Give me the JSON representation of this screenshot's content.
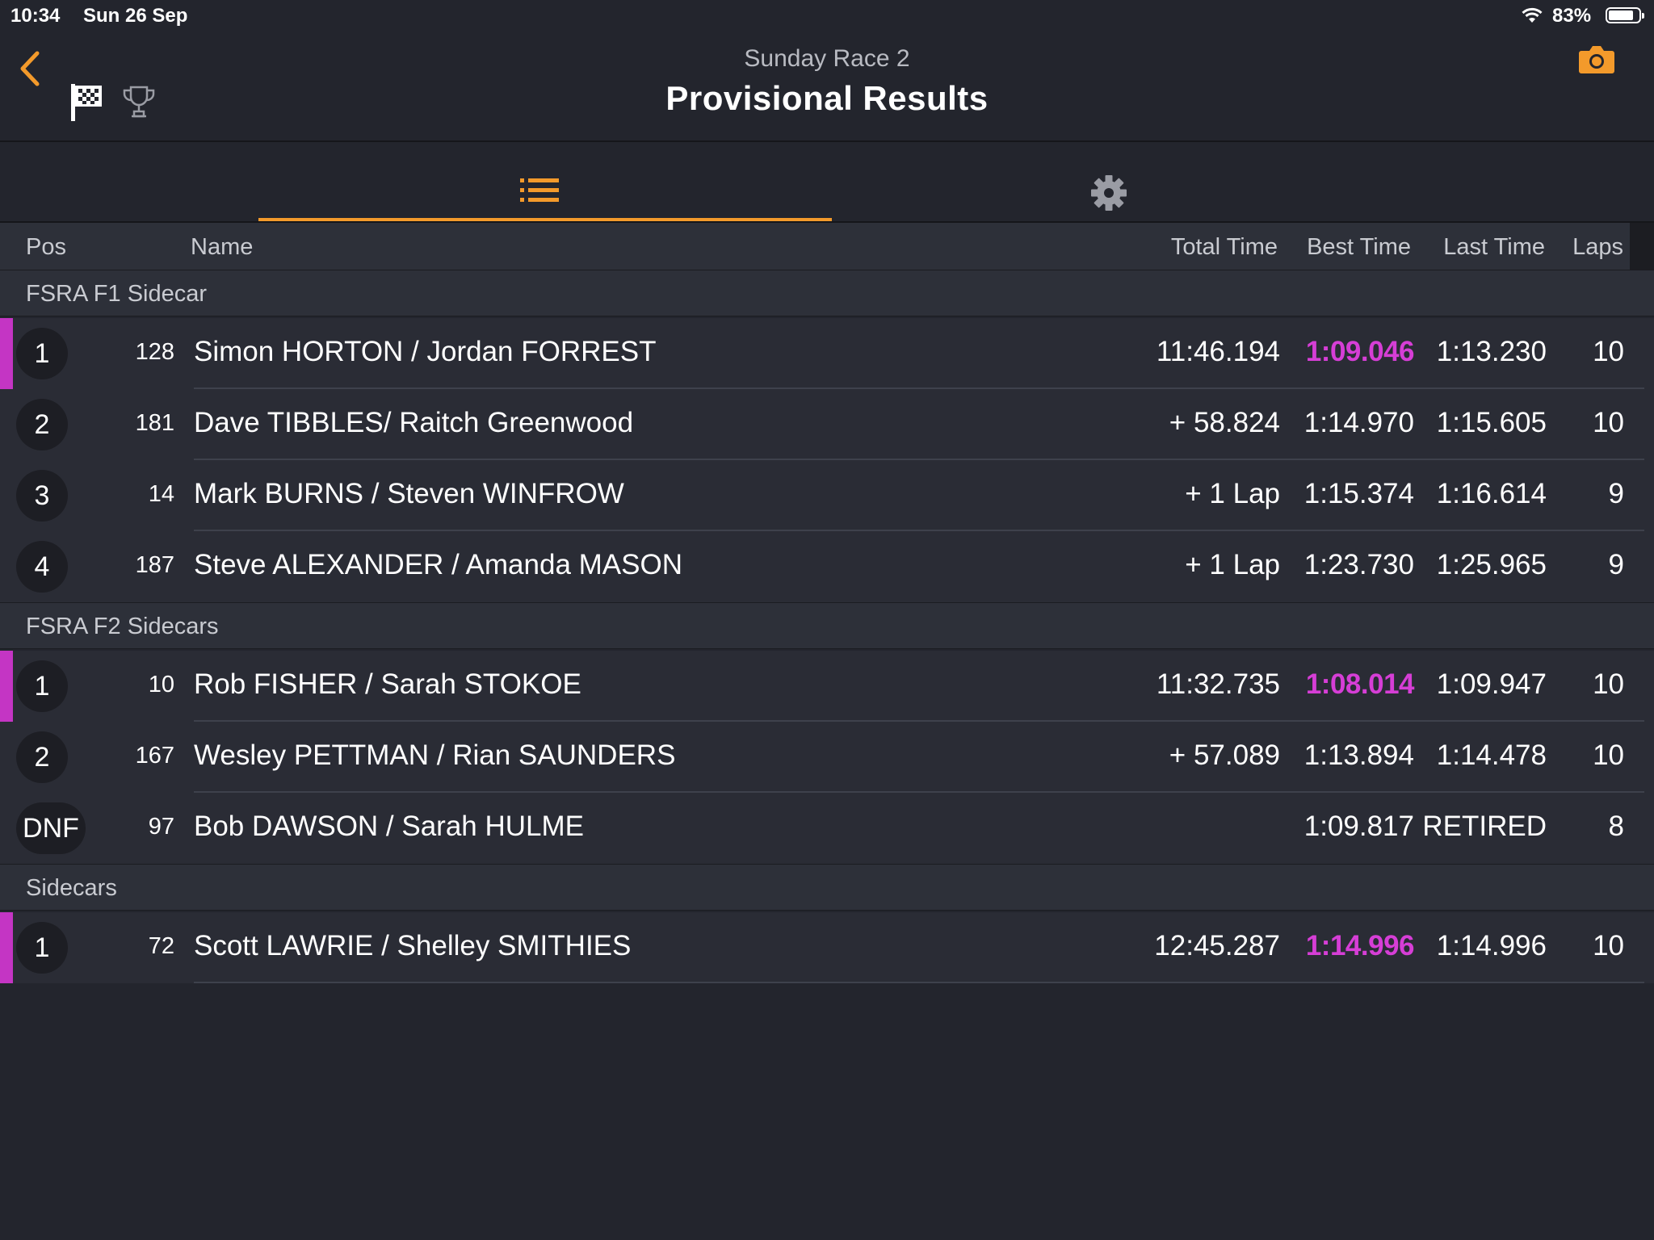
{
  "status_bar": {
    "time": "10:34",
    "date": "Sun 26 Sep",
    "battery": "83%",
    "battery_level": 0.83
  },
  "header": {
    "subtitle": "Sunday Race 2",
    "title": "Provisional Results"
  },
  "icons": {
    "back": "chevron-left-icon",
    "flag": "checkered-flag-icon",
    "trophy": "trophy-icon",
    "camera": "camera-icon",
    "list_tab": "list-icon",
    "settings_tab": "gear-icon"
  },
  "colors": {
    "accent": "#f39a2b",
    "fastest": "#d63ed6",
    "background": "#23252d"
  },
  "columns": {
    "pos": "Pos",
    "name": "Name",
    "total": "Total Time",
    "best": "Best Time",
    "last": "Last Time",
    "laps": "Laps"
  },
  "groups": [
    {
      "name": "FSRA F1 Sidecar",
      "rows": [
        {
          "pos": "1",
          "num": "128",
          "name": "Simon HORTON / Jordan FORREST",
          "total": "11:46.194",
          "best": "1:09.046",
          "last": "1:13.230",
          "laps": "10"
        },
        {
          "pos": "2",
          "num": "181",
          "name": "Dave TIBBLES/ Raitch Greenwood",
          "total": "+ 58.824",
          "best": "1:14.970",
          "last": "1:15.605",
          "laps": "10"
        },
        {
          "pos": "3",
          "num": "14",
          "name": "Mark BURNS / Steven WINFROW",
          "total": "+ 1 Lap",
          "best": "1:15.374",
          "last": "1:16.614",
          "laps": "9"
        },
        {
          "pos": "4",
          "num": "187",
          "name": "Steve ALEXANDER / Amanda MASON",
          "total": "+ 1 Lap",
          "best": "1:23.730",
          "last": "1:25.965",
          "laps": "9"
        }
      ]
    },
    {
      "name": "FSRA F2 Sidecars",
      "rows": [
        {
          "pos": "1",
          "num": "10",
          "name": "Rob FISHER / Sarah STOKOE",
          "total": "11:32.735",
          "best": "1:08.014",
          "last": "1:09.947",
          "laps": "10"
        },
        {
          "pos": "2",
          "num": "167",
          "name": "Wesley PETTMAN / Rian SAUNDERS",
          "total": "+ 57.089",
          "best": "1:13.894",
          "last": "1:14.478",
          "laps": "10"
        },
        {
          "pos": "DNF",
          "num": "97",
          "name": "Bob DAWSON / Sarah HULME",
          "total": "",
          "best": "1:09.817",
          "last": "RETIRED",
          "laps": "8"
        }
      ]
    },
    {
      "name": "Sidecars",
      "rows": [
        {
          "pos": "1",
          "num": "72",
          "name": "Scott LAWRIE / Shelley SMITHIES",
          "total": "12:45.287",
          "best": "1:14.996",
          "last": "1:14.996",
          "laps": "10"
        }
      ]
    }
  ]
}
